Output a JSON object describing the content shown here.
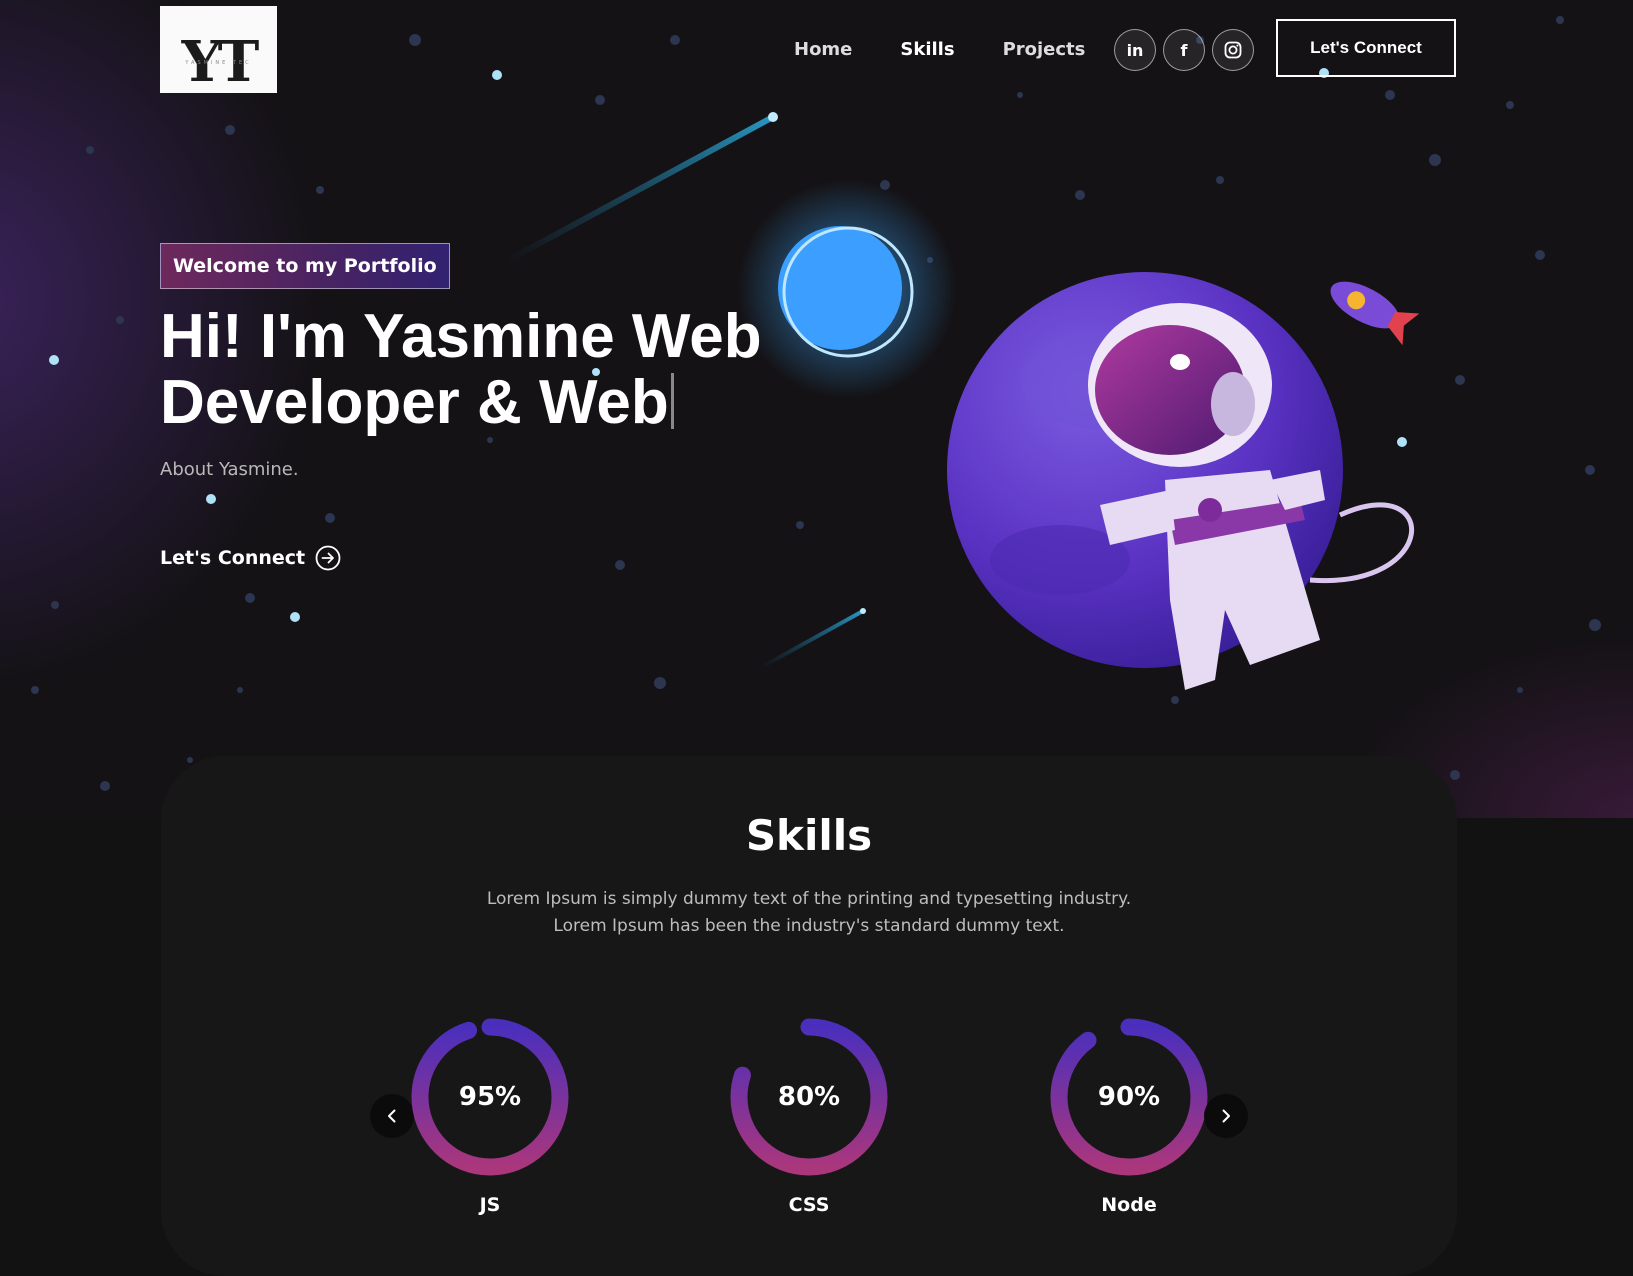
{
  "brand": {
    "logo_mark": "YT",
    "logo_subtext": "YASMINE TEC"
  },
  "nav": {
    "links": [
      {
        "label": "Home"
      },
      {
        "label": "Skills"
      },
      {
        "label": "Projects"
      }
    ],
    "socials": [
      {
        "label": "in",
        "icon": "linkedin-icon"
      },
      {
        "label": "f",
        "icon": "facebook-icon"
      },
      {
        "label": "",
        "icon": "instagram-icon"
      }
    ],
    "cta_label": "Let's Connect"
  },
  "hero": {
    "badge": "Welcome to my Portfolio",
    "headline": "Hi! I'm Yasmine Web Developer & Web",
    "about": "About Yasmine.",
    "cta_label": "Let's Connect",
    "cta_icon": "arrow-right-circle-icon"
  },
  "skills": {
    "title": "Skills",
    "description_line1": "Lorem Ipsum is simply dummy text of the printing and typesetting industry.",
    "description_line2": "Lorem Ipsum has been the industry's standard dummy text.",
    "items": [
      {
        "percent_label": "95%",
        "name": "JS",
        "progress": 0.95
      },
      {
        "percent_label": "80%",
        "name": "CSS",
        "progress": 0.8
      },
      {
        "percent_label": "90%",
        "name": "Node",
        "progress": 0.9
      }
    ],
    "prev_icon": "chevron-left-icon",
    "next_icon": "chevron-right-icon"
  },
  "colors": {
    "accent_pink": "#AA367C",
    "accent_purple": "#4A2FBD",
    "background": "#121212",
    "card": "#171717"
  }
}
